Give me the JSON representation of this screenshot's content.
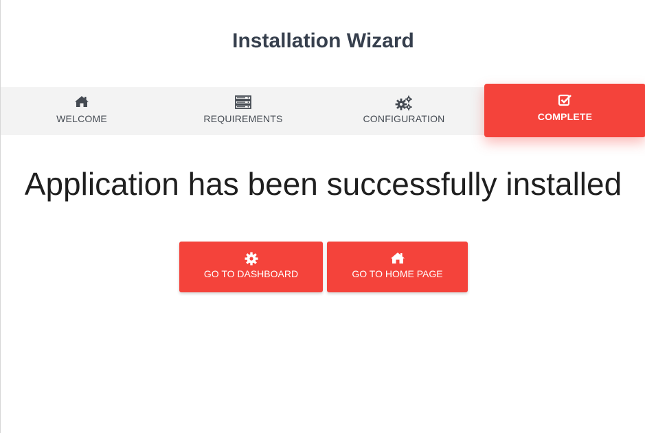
{
  "header": {
    "title": "Installation Wizard"
  },
  "steps": [
    {
      "label": "WELCOME",
      "icon": "home-icon",
      "active": false
    },
    {
      "label": "REQUIREMENTS",
      "icon": "server-icon",
      "active": false
    },
    {
      "label": "CONFIGURATION",
      "icon": "gears-icon",
      "active": false
    },
    {
      "label": "COMPLETE",
      "icon": "check-square-icon",
      "active": true
    }
  ],
  "main": {
    "message": "Application has been successfully installed",
    "buttons": [
      {
        "label": "GO TO DASHBOARD",
        "icon": "gear-icon"
      },
      {
        "label": "GO TO HOME PAGE",
        "icon": "home-icon"
      }
    ]
  },
  "colors": {
    "accent": "#f4433b",
    "steps_bar": "#f3f3f3",
    "title_text": "#363f4d"
  }
}
